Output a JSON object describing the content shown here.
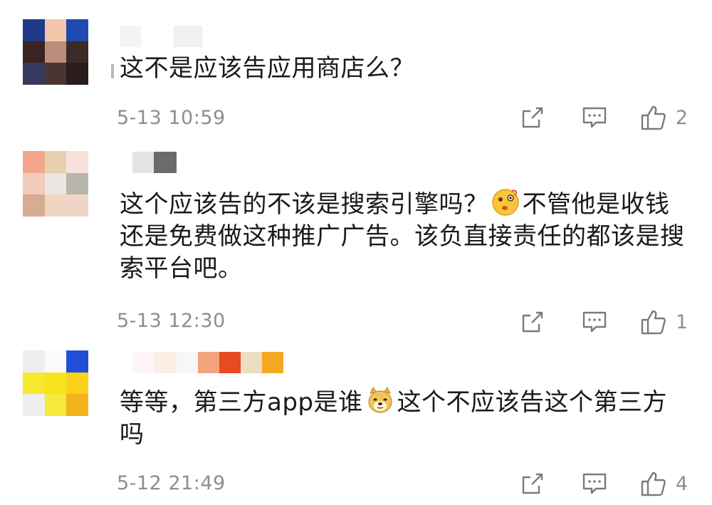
{
  "comments": [
    {
      "text_parts": [
        "这不是应该告应用商店么？"
      ],
      "timestamp": "5-13 10:59",
      "likes": "2",
      "emoji": ""
    },
    {
      "text_parts": [
        "这个应该告的不该是搜索引擎吗？",
        "不管他是收钱还是免费做这种推广广告。该负直接责任的都该是搜索平台吧。"
      ],
      "timestamp": "5-13 12:30",
      "likes": "1",
      "emoji": "thinking-face-emoji"
    },
    {
      "text_parts": [
        "等等，第三方app是谁",
        "这个不应该告这个第三方吗"
      ],
      "timestamp": "5-12 21:49",
      "likes": "4",
      "emoji": "doge-emoji"
    }
  ],
  "icons": {
    "share": "share-icon",
    "reply": "reply-icon",
    "like": "thumbs-up-icon"
  },
  "colors": {
    "text": "#1a1a1a",
    "meta": "#8e8e8e",
    "icon": "#7a7a7a"
  }
}
